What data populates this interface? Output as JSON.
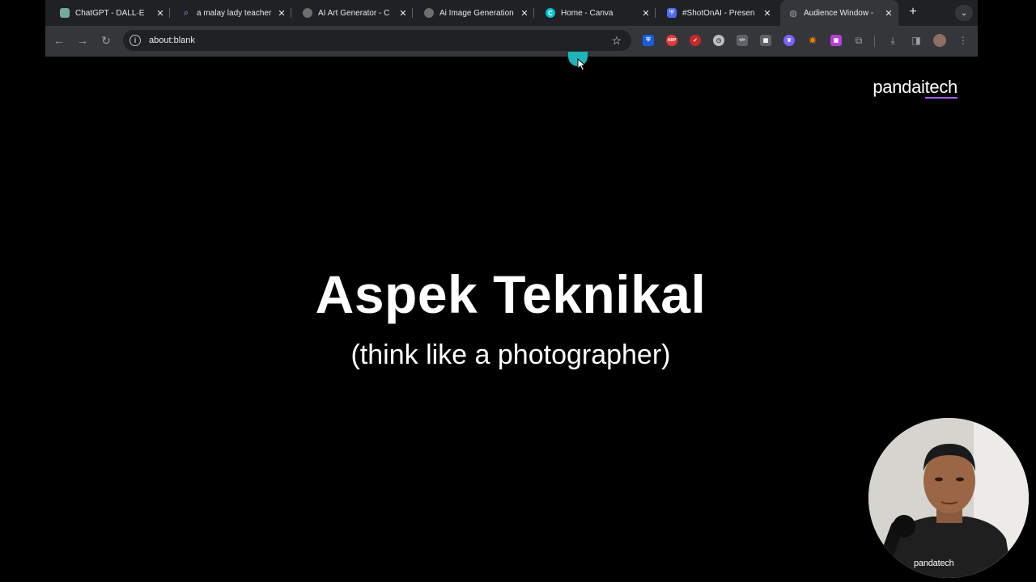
{
  "browser": {
    "tabs": [
      {
        "title": "ChatGPT - DALL·E",
        "icon": "chatgpt-favicon",
        "color": "#74aa9c"
      },
      {
        "title": "a malay lady teacher",
        "icon": "search-favicon",
        "color": "#4285f4"
      },
      {
        "title": "AI Art Generator - C",
        "icon": "ai-art-favicon",
        "color": "#6e6e6e"
      },
      {
        "title": "Ai Image Generation",
        "icon": "ai-image-favicon",
        "color": "#6e6e6e"
      },
      {
        "title": "Home - Canva",
        "icon": "canva-favicon",
        "color": "#00c4cc"
      },
      {
        "title": "#ShotOnAI - Presen",
        "icon": "shield-favicon",
        "color": "#4f6bed"
      },
      {
        "title": "Audience Window - ",
        "icon": "globe-favicon",
        "color": "#9aa0a6"
      }
    ],
    "active_tab": 6,
    "address": "about:blank",
    "extensions": [
      {
        "name": "bitwarden-icon",
        "color": "#175ddc",
        "glyph": "⛨"
      },
      {
        "name": "adblock-plus-icon",
        "color": "#e33",
        "glyph": "ABP"
      },
      {
        "name": "red-check-icon",
        "color": "#c62828",
        "glyph": "✓"
      },
      {
        "name": "clock-icon",
        "color": "#bdbdbd",
        "glyph": "◷"
      },
      {
        "name": "code-icon",
        "color": "#5f6368",
        "glyph": "</>"
      },
      {
        "name": "puzzle-grid-icon",
        "color": "#5f6368",
        "glyph": "▦"
      },
      {
        "name": "feather-icon",
        "color": "#7b61ff",
        "glyph": "❦"
      },
      {
        "name": "spark-icon",
        "color": "#f57c00",
        "glyph": "✷"
      },
      {
        "name": "purple-square-icon",
        "color": "#b83dd6",
        "glyph": "■"
      }
    ]
  },
  "slide": {
    "logo_prefix": "pandai",
    "logo_suffix": "tech",
    "title": "Aspek Teknikal",
    "subtitle": "(think like a photographer)"
  },
  "webcam": {
    "caption": "pandatech"
  }
}
